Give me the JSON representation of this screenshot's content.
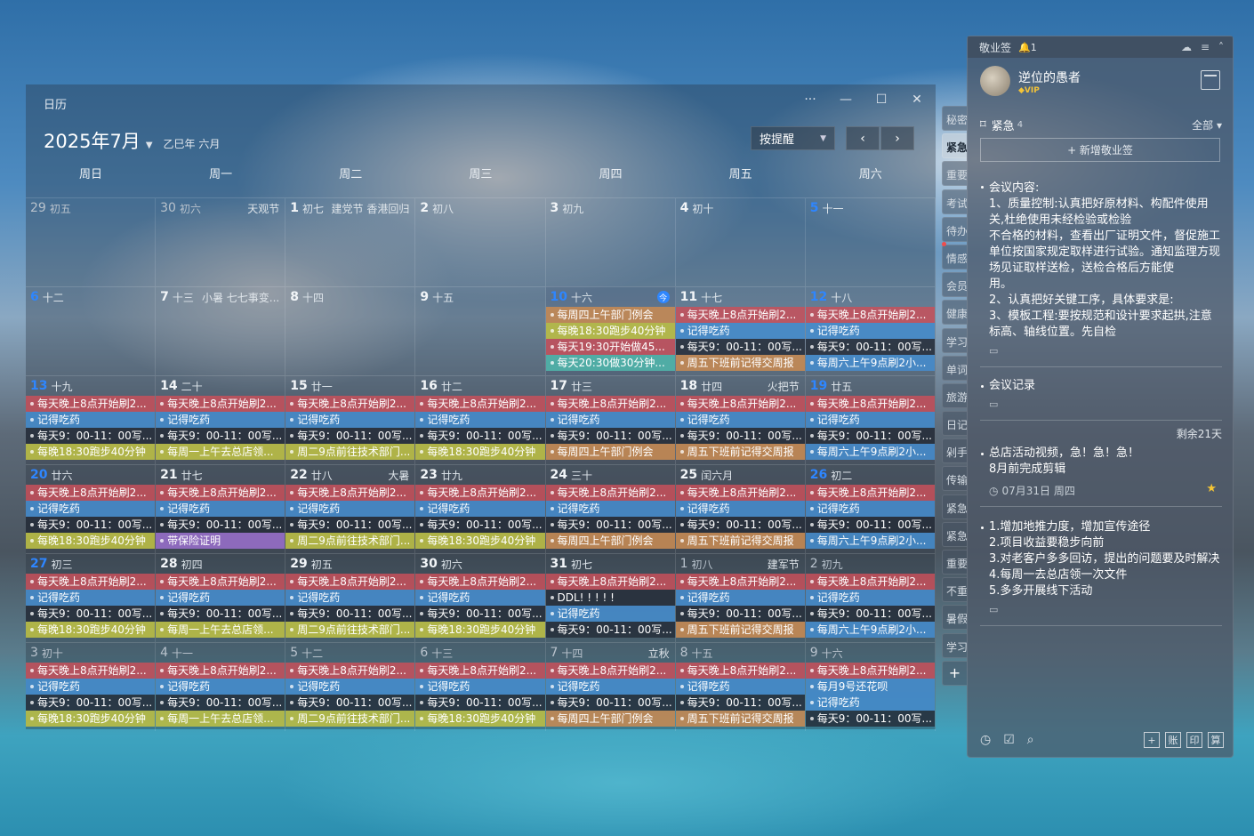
{
  "calendar": {
    "title": "日历",
    "month": "2025年7月",
    "lunar_year": "乙巳年 六月",
    "remind_label": "按提醒",
    "prev_icon": "‹",
    "next_icon": "›",
    "win": {
      "more": "···",
      "min": "—",
      "max": "☐",
      "close": "✕"
    },
    "weekdays": [
      "周日",
      "周一",
      "周二",
      "周三",
      "周四",
      "周五",
      "周六"
    ],
    "weeks": [
      [
        {
          "d": "29",
          "l": "初五",
          "dim": true
        },
        {
          "d": "30",
          "l": "初六",
          "dim": true,
          "f": "天观节"
        },
        {
          "d": "1",
          "l": "初七",
          "f": "建党节 香港回归"
        },
        {
          "d": "2",
          "l": "初八"
        },
        {
          "d": "3",
          "l": "初九"
        },
        {
          "d": "4",
          "l": "初十"
        },
        {
          "d": "5",
          "l": "十一",
          "blue": true
        }
      ],
      [
        {
          "d": "6",
          "l": "十二",
          "blue": true
        },
        {
          "d": "7",
          "l": "十三",
          "f": "小暑 七七事变..."
        },
        {
          "d": "8",
          "l": "十四"
        },
        {
          "d": "9",
          "l": "十五"
        },
        {
          "d": "10",
          "l": "十六",
          "blue": true,
          "today": true,
          "badge": "今",
          "ev": [
            [
              "o",
              "每周四上午部门例会"
            ],
            [
              "y",
              "每晚18:30跑步40分钟"
            ],
            [
              "r",
              "每天19:30开始做45..."
            ],
            [
              "t",
              "每天20:30做30分钟..."
            ]
          ]
        },
        {
          "d": "11",
          "l": "十七",
          "ev": [
            [
              "r",
              "每天晚上8点开始刷2..."
            ],
            [
              "b",
              "记得吃药"
            ],
            [
              "k",
              "每天9：00-11：00写..."
            ],
            [
              "o",
              "周五下班前记得交周报"
            ]
          ]
        },
        {
          "d": "12",
          "l": "十八",
          "blue": true,
          "ev": [
            [
              "r",
              "每天晚上8点开始刷2..."
            ],
            [
              "b",
              "记得吃药"
            ],
            [
              "k",
              "每天9：00-11：00写..."
            ],
            [
              "b",
              "每周六上午9点刷2小..."
            ]
          ]
        }
      ],
      [
        {
          "d": "13",
          "l": "十九",
          "blue": true,
          "ev": [
            [
              "r",
              "每天晚上8点开始刷2..."
            ],
            [
              "b",
              "记得吃药"
            ],
            [
              "k",
              "每天9：00-11：00写..."
            ],
            [
              "y",
              "每晚18:30跑步40分钟"
            ]
          ]
        },
        {
          "d": "14",
          "l": "二十",
          "ev": [
            [
              "r",
              "每天晚上8点开始刷2..."
            ],
            [
              "b",
              "记得吃药"
            ],
            [
              "k",
              "每天9：00-11：00写..."
            ],
            [
              "y",
              "每周一上午去总店领..."
            ]
          ]
        },
        {
          "d": "15",
          "l": "廿一",
          "ev": [
            [
              "r",
              "每天晚上8点开始刷2..."
            ],
            [
              "b",
              "记得吃药"
            ],
            [
              "k",
              "每天9：00-11：00写..."
            ],
            [
              "y",
              "周二9点前往技术部门..."
            ]
          ]
        },
        {
          "d": "16",
          "l": "廿二",
          "ev": [
            [
              "r",
              "每天晚上8点开始刷2..."
            ],
            [
              "b",
              "记得吃药"
            ],
            [
              "k",
              "每天9：00-11：00写..."
            ],
            [
              "y",
              "每晚18:30跑步40分钟"
            ]
          ]
        },
        {
          "d": "17",
          "l": "廿三",
          "ev": [
            [
              "r",
              "每天晚上8点开始刷2..."
            ],
            [
              "b",
              "记得吃药"
            ],
            [
              "k",
              "每天9：00-11：00写..."
            ],
            [
              "o",
              "每周四上午部门例会"
            ]
          ]
        },
        {
          "d": "18",
          "l": "廿四",
          "f": "火把节",
          "ev": [
            [
              "r",
              "每天晚上8点开始刷2..."
            ],
            [
              "b",
              "记得吃药"
            ],
            [
              "k",
              "每天9：00-11：00写..."
            ],
            [
              "o",
              "周五下班前记得交周报"
            ]
          ]
        },
        {
          "d": "19",
          "l": "廿五",
          "blue": true,
          "ev": [
            [
              "r",
              "每天晚上8点开始刷2..."
            ],
            [
              "b",
              "记得吃药"
            ],
            [
              "k",
              "每天9：00-11：00写..."
            ],
            [
              "b",
              "每周六上午9点刷2小..."
            ]
          ]
        }
      ],
      [
        {
          "d": "20",
          "l": "廿六",
          "blue": true,
          "ev": [
            [
              "r",
              "每天晚上8点开始刷2..."
            ],
            [
              "b",
              "记得吃药"
            ],
            [
              "k",
              "每天9：00-11：00写..."
            ],
            [
              "y",
              "每晚18:30跑步40分钟"
            ]
          ]
        },
        {
          "d": "21",
          "l": "廿七",
          "ev": [
            [
              "r",
              "每天晚上8点开始刷2..."
            ],
            [
              "b",
              "记得吃药"
            ],
            [
              "k",
              "每天9：00-11：00写..."
            ],
            [
              "p",
              "带保险证明"
            ]
          ]
        },
        {
          "d": "22",
          "l": "廿八",
          "f": "大暑",
          "ev": [
            [
              "r",
              "每天晚上8点开始刷2..."
            ],
            [
              "b",
              "记得吃药"
            ],
            [
              "k",
              "每天9：00-11：00写..."
            ],
            [
              "y",
              "周二9点前往技术部门..."
            ]
          ]
        },
        {
          "d": "23",
          "l": "廿九",
          "ev": [
            [
              "r",
              "每天晚上8点开始刷2..."
            ],
            [
              "b",
              "记得吃药"
            ],
            [
              "k",
              "每天9：00-11：00写..."
            ],
            [
              "y",
              "每晚18:30跑步40分钟"
            ]
          ]
        },
        {
          "d": "24",
          "l": "三十",
          "ev": [
            [
              "r",
              "每天晚上8点开始刷2..."
            ],
            [
              "b",
              "记得吃药"
            ],
            [
              "k",
              "每天9：00-11：00写..."
            ],
            [
              "o",
              "每周四上午部门例会"
            ]
          ]
        },
        {
          "d": "25",
          "l": "闰六月",
          "ev": [
            [
              "r",
              "每天晚上8点开始刷2..."
            ],
            [
              "b",
              "记得吃药"
            ],
            [
              "k",
              "每天9：00-11：00写..."
            ],
            [
              "o",
              "周五下班前记得交周报"
            ]
          ]
        },
        {
          "d": "26",
          "l": "初二",
          "blue": true,
          "ev": [
            [
              "r",
              "每天晚上8点开始刷2..."
            ],
            [
              "b",
              "记得吃药"
            ],
            [
              "k",
              "每天9：00-11：00写..."
            ],
            [
              "b",
              "每周六上午9点刷2小..."
            ]
          ]
        }
      ],
      [
        {
          "d": "27",
          "l": "初三",
          "blue": true,
          "ev": [
            [
              "r",
              "每天晚上8点开始刷2..."
            ],
            [
              "b",
              "记得吃药"
            ],
            [
              "k",
              "每天9：00-11：00写..."
            ],
            [
              "y",
              "每晚18:30跑步40分钟"
            ]
          ]
        },
        {
          "d": "28",
          "l": "初四",
          "ev": [
            [
              "r",
              "每天晚上8点开始刷2..."
            ],
            [
              "b",
              "记得吃药"
            ],
            [
              "k",
              "每天9：00-11：00写..."
            ],
            [
              "y",
              "每周一上午去总店领..."
            ]
          ]
        },
        {
          "d": "29",
          "l": "初五",
          "ev": [
            [
              "r",
              "每天晚上8点开始刷2..."
            ],
            [
              "b",
              "记得吃药"
            ],
            [
              "k",
              "每天9：00-11：00写..."
            ],
            [
              "y",
              "周二9点前往技术部门..."
            ]
          ]
        },
        {
          "d": "30",
          "l": "初六",
          "ev": [
            [
              "r",
              "每天晚上8点开始刷2..."
            ],
            [
              "b",
              "记得吃药"
            ],
            [
              "k",
              "每天9：00-11：00写..."
            ],
            [
              "y",
              "每晚18:30跑步40分钟"
            ]
          ]
        },
        {
          "d": "31",
          "l": "初七",
          "ev": [
            [
              "r",
              "每天晚上8点开始刷2..."
            ],
            [
              "k",
              "DDL! ! ! ! !"
            ],
            [
              "b",
              "记得吃药"
            ],
            [
              "k",
              "每天9：00-11：00写..."
            ]
          ]
        },
        {
          "d": "1",
          "l": "初八",
          "dim": true,
          "f": "建军节",
          "ev": [
            [
              "r",
              "每天晚上8点开始刷2..."
            ],
            [
              "b",
              "记得吃药"
            ],
            [
              "k",
              "每天9：00-11：00写..."
            ],
            [
              "o",
              "周五下班前记得交周报"
            ]
          ]
        },
        {
          "d": "2",
          "l": "初九",
          "dim": true,
          "ev": [
            [
              "r",
              "每天晚上8点开始刷2..."
            ],
            [
              "b",
              "记得吃药"
            ],
            [
              "k",
              "每天9：00-11：00写..."
            ],
            [
              "b",
              "每周六上午9点刷2小..."
            ]
          ]
        }
      ],
      [
        {
          "d": "3",
          "l": "初十",
          "dim": true,
          "ev": [
            [
              "r",
              "每天晚上8点开始刷2..."
            ],
            [
              "b",
              "记得吃药"
            ],
            [
              "k",
              "每天9：00-11：00写..."
            ],
            [
              "y",
              "每晚18:30跑步40分钟"
            ]
          ]
        },
        {
          "d": "4",
          "l": "十一",
          "dim": true,
          "ev": [
            [
              "r",
              "每天晚上8点开始刷2..."
            ],
            [
              "b",
              "记得吃药"
            ],
            [
              "k",
              "每天9：00-11：00写..."
            ],
            [
              "y",
              "每周一上午去总店领..."
            ]
          ]
        },
        {
          "d": "5",
          "l": "十二",
          "dim": true,
          "ev": [
            [
              "r",
              "每天晚上8点开始刷2..."
            ],
            [
              "b",
              "记得吃药"
            ],
            [
              "k",
              "每天9：00-11：00写..."
            ],
            [
              "y",
              "周二9点前往技术部门..."
            ]
          ]
        },
        {
          "d": "6",
          "l": "十三",
          "dim": true,
          "ev": [
            [
              "r",
              "每天晚上8点开始刷2..."
            ],
            [
              "b",
              "记得吃药"
            ],
            [
              "k",
              "每天9：00-11：00写..."
            ],
            [
              "y",
              "每晚18:30跑步40分钟"
            ]
          ]
        },
        {
          "d": "7",
          "l": "十四",
          "dim": true,
          "f": "立秋",
          "ev": [
            [
              "r",
              "每天晚上8点开始刷2..."
            ],
            [
              "b",
              "记得吃药"
            ],
            [
              "k",
              "每天9：00-11：00写..."
            ],
            [
              "o",
              "每周四上午部门例会"
            ]
          ]
        },
        {
          "d": "8",
          "l": "十五",
          "dim": true,
          "ev": [
            [
              "r",
              "每天晚上8点开始刷2..."
            ],
            [
              "b",
              "记得吃药"
            ],
            [
              "k",
              "每天9：00-11：00写..."
            ],
            [
              "o",
              "周五下班前记得交周报"
            ]
          ]
        },
        {
          "d": "9",
          "l": "十六",
          "dim": true,
          "ev": [
            [
              "r",
              "每天晚上8点开始刷2..."
            ],
            [
              "b",
              "每月9号还花呗"
            ],
            [
              "b",
              "记得吃药"
            ],
            [
              "k",
              "每天9：00-11：00写..."
            ]
          ]
        }
      ]
    ]
  },
  "tabs": [
    "秘密",
    "紧急",
    "重要",
    "考试",
    "待办",
    "情感",
    "会员",
    "健康",
    "学习",
    "单词",
    "旅游",
    "日记",
    "剁手",
    "传输",
    "紧急",
    "紧急",
    "重要",
    "不重",
    "暑假",
    "学习",
    "+"
  ],
  "active_tab": 1,
  "panel": {
    "app_name": "敬业签",
    "bell": "🔔1",
    "user": "逆位的愚者",
    "vip": "◆VIP",
    "section": "紧急",
    "section_count": "4",
    "all_label": "全部 ▾",
    "add_label": "+ 新增敬业签",
    "notes": [
      {
        "text": "会议内容:\n1、质量控制:认真把好原材料、构配件使用关,杜绝使用未经检验或检验\n不合格的材料，查看出厂证明文件，督促施工单位按国家规定取样进行试验。通知监理方现场见证取样送检，送检合格后方能使\n用。\n2、认真把好关键工序，具体要求是:\n3、模板工程:要按规范和设计要求起拱,注意标高、轴线位置。先自检"
      },
      {
        "text": "会议记录"
      },
      {
        "text": "总店活动视频，急！急！急！\n8月前完成剪辑",
        "remain": "剩余21天",
        "date": "07月31日 周四"
      },
      {
        "text": "1.增加地推力度，增加宣传途径\n2.项目收益要稳步向前\n3.对老客户多多回访，提出的问题要及时解决\n4.每周一去总店领一次文件\n5.多多开展线下活动"
      }
    ],
    "footer": [
      "账",
      "印",
      "算"
    ]
  }
}
